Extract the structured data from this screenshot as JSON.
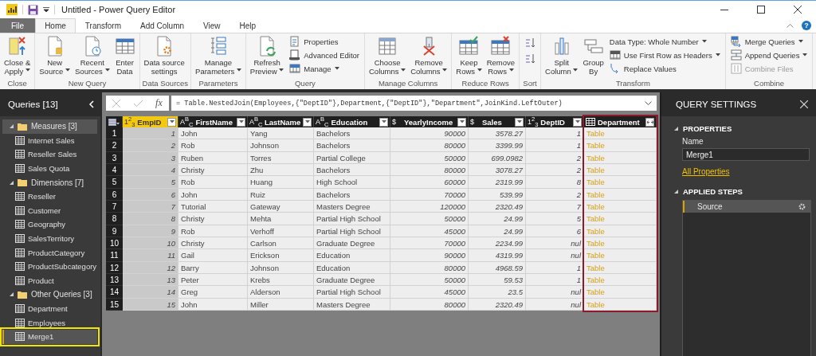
{
  "window": {
    "title": "Untitled - Power Query Editor"
  },
  "ribbon": {
    "help": "?",
    "tabs": [
      {
        "label": "File",
        "kind": "file",
        "selected": false
      },
      {
        "label": "Home",
        "kind": "tab",
        "selected": true
      },
      {
        "label": "Transform",
        "kind": "tab",
        "selected": false
      },
      {
        "label": "Add Column",
        "kind": "tab",
        "selected": false
      },
      {
        "label": "View",
        "kind": "tab",
        "selected": false
      },
      {
        "label": "Help",
        "kind": "tab",
        "selected": false
      }
    ],
    "groups": [
      {
        "label": "Close",
        "items": [
          {
            "kind": "large",
            "lines": [
              "Close &",
              "Apply"
            ],
            "dropdown": true
          }
        ]
      },
      {
        "label": "New Query",
        "items": [
          {
            "kind": "large",
            "lines": [
              "New",
              "Source"
            ],
            "dropdown": true
          },
          {
            "kind": "large",
            "lines": [
              "Recent",
              "Sources"
            ],
            "dropdown": true
          },
          {
            "kind": "large",
            "lines": [
              "Enter",
              "Data"
            ],
            "dropdown": false
          }
        ]
      },
      {
        "label": "Data Sources",
        "items": [
          {
            "kind": "large",
            "lines": [
              "Data source",
              "settings"
            ],
            "dropdown": false
          }
        ]
      },
      {
        "label": "Parameters",
        "items": [
          {
            "kind": "large",
            "lines": [
              "Manage",
              "Parameters"
            ],
            "dropdown": true
          }
        ]
      },
      {
        "label": "Query",
        "items": [
          {
            "kind": "large",
            "lines": [
              "Refresh",
              "Preview"
            ],
            "dropdown": true
          },
          {
            "kind": "small",
            "label": "Properties",
            "dropdown": false,
            "disabled": false
          },
          {
            "kind": "small",
            "label": "Advanced Editor",
            "dropdown": false,
            "disabled": false
          },
          {
            "kind": "small",
            "label": "Manage",
            "dropdown": true,
            "disabled": false
          }
        ]
      },
      {
        "label": "Manage Columns",
        "items": [
          {
            "kind": "large",
            "lines": [
              "Choose",
              "Columns"
            ],
            "dropdown": true
          },
          {
            "kind": "large",
            "lines": [
              "Remove",
              "Columns"
            ],
            "dropdown": true
          }
        ]
      },
      {
        "label": "Reduce Rows",
        "items": [
          {
            "kind": "large",
            "lines": [
              "Keep",
              "Rows"
            ],
            "dropdown": true
          },
          {
            "kind": "large",
            "lines": [
              "Remove",
              "Rows"
            ],
            "dropdown": true
          }
        ]
      },
      {
        "label": "Sort",
        "items": [
          {
            "kind": "icon"
          },
          {
            "kind": "icon"
          }
        ]
      },
      {
        "label": "Transform",
        "items": [
          {
            "kind": "large",
            "lines": [
              "Split",
              "Column"
            ],
            "dropdown": true
          },
          {
            "kind": "large",
            "lines": [
              "Group",
              "By"
            ],
            "dropdown": false
          },
          {
            "kind": "small",
            "label": "Data Type: Whole Number",
            "dropdown": true,
            "disabled": false
          },
          {
            "kind": "small",
            "label": "Use First Row as Headers",
            "dropdown": true,
            "disabled": false
          },
          {
            "kind": "small",
            "label": "Replace Values",
            "dropdown": false,
            "disabled": false
          }
        ]
      },
      {
        "label": "Combine",
        "items": [
          {
            "kind": "small",
            "label": "Merge Queries",
            "dropdown": true,
            "disabled": false
          },
          {
            "kind": "small",
            "label": "Append Queries",
            "dropdown": true,
            "disabled": false
          },
          {
            "kind": "small",
            "label": "Combine Files",
            "dropdown": false,
            "disabled": true
          }
        ]
      }
    ]
  },
  "queries": {
    "title": "Queries [13]",
    "groups": [
      {
        "label": "Measures [3]",
        "expanded": true,
        "selected": true,
        "children": [
          {
            "label": "Internet Sales",
            "selected": false,
            "outlined": false
          },
          {
            "label": "Reseller Sales",
            "selected": false,
            "outlined": false
          },
          {
            "label": "Sales Quota",
            "selected": false,
            "outlined": false
          }
        ]
      },
      {
        "label": "Dimensions [7]",
        "expanded": true,
        "selected": false,
        "children": [
          {
            "label": "Reseller",
            "selected": false,
            "outlined": false
          },
          {
            "label": "Customer",
            "selected": false,
            "outlined": false
          },
          {
            "label": "Geography",
            "selected": false,
            "outlined": false
          },
          {
            "label": "SalesTerritory",
            "selected": false,
            "outlined": false
          },
          {
            "label": "ProductCategory",
            "selected": false,
            "outlined": false
          },
          {
            "label": "ProductSubcategory",
            "selected": false,
            "outlined": false
          },
          {
            "label": "Product",
            "selected": false,
            "outlined": false
          }
        ]
      },
      {
        "label": "Other Queries [3]",
        "expanded": true,
        "selected": false,
        "children": [
          {
            "label": "Department",
            "selected": false,
            "outlined": false
          },
          {
            "label": "Employees",
            "selected": false,
            "outlined": false
          },
          {
            "label": "Merge1",
            "selected": true,
            "outlined": true
          }
        ]
      }
    ]
  },
  "formula_bar": {
    "fx": "fx",
    "formula": "= Table.NestedJoin(Employees,{\"DeptID\"},Department,{\"DeptID\"},\"Department\",JoinKind.LeftOuter)"
  },
  "table": {
    "columns": [
      {
        "name": "EmpID",
        "kind": "number",
        "type_icon": "1$^{2}$$_{3}$",
        "selected": true,
        "outlined": false
      },
      {
        "name": "FirstName",
        "kind": "text",
        "type_icon": "A$^{B}$$_{C}$",
        "selected": false,
        "outlined": false
      },
      {
        "name": "LastName",
        "kind": "text",
        "type_icon": "A$^{B}$$_{C}$",
        "selected": false,
        "outlined": false
      },
      {
        "name": "Education",
        "kind": "text",
        "type_icon": "A$^{B}$$_{C}$",
        "selected": false,
        "outlined": false
      },
      {
        "name": "YearlyIncome",
        "kind": "currency",
        "type_icon": "$",
        "selected": false,
        "outlined": false
      },
      {
        "name": "Sales",
        "kind": "currency",
        "type_icon": "$",
        "selected": false,
        "outlined": false
      },
      {
        "name": "DeptID",
        "kind": "number",
        "type_icon": "1$^{2}$$_{3}$",
        "selected": false,
        "outlined": false
      },
      {
        "name": "Department",
        "kind": "table",
        "selected": false,
        "outlined": true
      }
    ],
    "rows": [
      {
        "number": "1",
        "cells": [
          "1",
          "John",
          "Yang",
          "Bachelors",
          "90000",
          "3578.27",
          "1",
          "Table"
        ]
      },
      {
        "number": "2",
        "cells": [
          "2",
          "Rob",
          "Johnson",
          "Bachelors",
          "80000",
          "3399.99",
          "1",
          "Table"
        ]
      },
      {
        "number": "3",
        "cells": [
          "3",
          "Ruben",
          "Torres",
          "Partial College",
          "50000",
          "699.0982",
          "2",
          "Table"
        ]
      },
      {
        "number": "4",
        "cells": [
          "4",
          "Christy",
          "Zhu",
          "Bachelors",
          "80000",
          "3078.27",
          "2",
          "Table"
        ]
      },
      {
        "number": "5",
        "cells": [
          "5",
          "Rob",
          "Huang",
          "High School",
          "60000",
          "2319.99",
          "8",
          "Table"
        ]
      },
      {
        "number": "6",
        "cells": [
          "6",
          "John",
          "Ruiz",
          "Bachelors",
          "70000",
          "539.99",
          "2",
          "Table"
        ]
      },
      {
        "number": "7",
        "cells": [
          "7",
          "Tutorial",
          "Gateway",
          "Masters Degree",
          "120000",
          "2320.49",
          "7",
          "Table"
        ]
      },
      {
        "number": "8",
        "cells": [
          "8",
          "Christy",
          "Mehta",
          "Partial High School",
          "50000",
          "24.99",
          "5",
          "Table"
        ]
      },
      {
        "number": "9",
        "cells": [
          "9",
          "Rob",
          "Verhoff",
          "Partial High School",
          "45000",
          "24.99",
          "6",
          "Table"
        ]
      },
      {
        "number": "10",
        "cells": [
          "10",
          "Christy",
          "Carlson",
          "Graduate Degree",
          "70000",
          "2234.99",
          "nul",
          "Table"
        ]
      },
      {
        "number": "11",
        "cells": [
          "11",
          "Gail",
          "Erickson",
          "Education",
          "90000",
          "4319.99",
          "nul",
          "Table"
        ]
      },
      {
        "number": "12",
        "cells": [
          "12",
          "Barry",
          "Johnson",
          "Education",
          "80000",
          "4968.59",
          "1",
          "Table"
        ]
      },
      {
        "number": "13",
        "cells": [
          "13",
          "Peter",
          "Krebs",
          "Graduate Degree",
          "50000",
          "59.53",
          "1",
          "Table"
        ]
      },
      {
        "number": "14",
        "cells": [
          "14",
          "Greg",
          "Alderson",
          "Partial High School",
          "45000",
          "23.5",
          "nul",
          "Table"
        ]
      },
      {
        "number": "15",
        "cells": [
          "15",
          "John",
          "Miller",
          "Masters Degree",
          "80000",
          "2320.49",
          "nul",
          "Table"
        ]
      }
    ]
  },
  "settings": {
    "title": "QUERY SETTINGS",
    "properties_heading": "PROPERTIES",
    "name_label": "Name",
    "name_value": "Merge1",
    "all_properties_link": "All Properties",
    "steps_heading": "APPLIED STEPS",
    "steps": [
      {
        "label": "Source",
        "selected": true
      }
    ]
  }
}
